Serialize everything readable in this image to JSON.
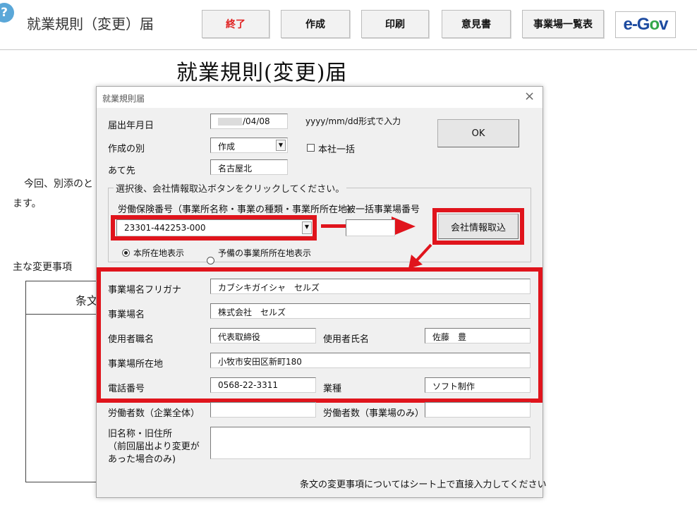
{
  "sheet": {
    "title": "就業規則（変更）届",
    "toolbar": {
      "end": "終了",
      "create": "作成",
      "print": "印刷",
      "opinion": "意見書",
      "site_list": "事業場一覧表"
    },
    "egov_logo": "e-Gov",
    "document_title": "就業規則(変更)届",
    "body_line1": "今回、別添のと",
    "body_line2": "ます。",
    "main_changes": "主な変更事項",
    "table_header": "条文",
    "help_icon": "?"
  },
  "dialog": {
    "title": "就業規則届",
    "close": "×",
    "submit_date": {
      "label": "届出年月日",
      "value": "/04/08",
      "hint": "yyyy/mm/dd形式で入力"
    },
    "creation_type": {
      "label": "作成の別",
      "value": "作成"
    },
    "head_office_bulk": {
      "label": "本社一括"
    },
    "addressee": {
      "label": "あて先",
      "value": "名古屋北"
    },
    "ok": "OK",
    "frame_caption": "選択後、会社情報取込ボタンをクリックしてください。",
    "insurance_number": {
      "label": "労働保険番号（事業所名称・事業の種類・事業所所在地）",
      "value": "23301-442253-000"
    },
    "bulk_site_number": {
      "label": "被一括事業場番号",
      "value": ""
    },
    "import_button": "会社情報取込",
    "location_radio": {
      "main": "本所在地表示",
      "reserve": "予備の事業所所在地表示"
    },
    "site_kana": {
      "label": "事業場名フリガナ",
      "value": "カブシキガイシャ　セルズ"
    },
    "site_name": {
      "label": "事業場名",
      "value": "株式会社　セルズ"
    },
    "employer_title": {
      "label": "使用者職名",
      "value": "代表取締役"
    },
    "employer_name": {
      "label": "使用者氏名",
      "value": "佐藤　豊"
    },
    "site_address": {
      "label": "事業場所在地",
      "value": "小牧市安田区新町180"
    },
    "phone": {
      "label": "電話番号",
      "value": "0568-22-3311"
    },
    "industry": {
      "label": "業種",
      "value": "ソフト制作"
    },
    "workers_company": {
      "label": "労働者数（企業全体）",
      "value": ""
    },
    "workers_site": {
      "label": "労働者数（事業場のみ）",
      "value": ""
    },
    "old_name": {
      "label_lines": [
        "旧名称・旧住所",
        "（前回届出より変更が",
        "あった場合のみ)"
      ],
      "value": ""
    },
    "footer_note": "条文の変更事項についてはシート上で直接入力してください"
  },
  "colors": {
    "highlight": "#e0141c",
    "dialog_bg": "#f0f0f0",
    "egov_blue": "#1d4ba0",
    "egov_green": "#33a64a"
  }
}
